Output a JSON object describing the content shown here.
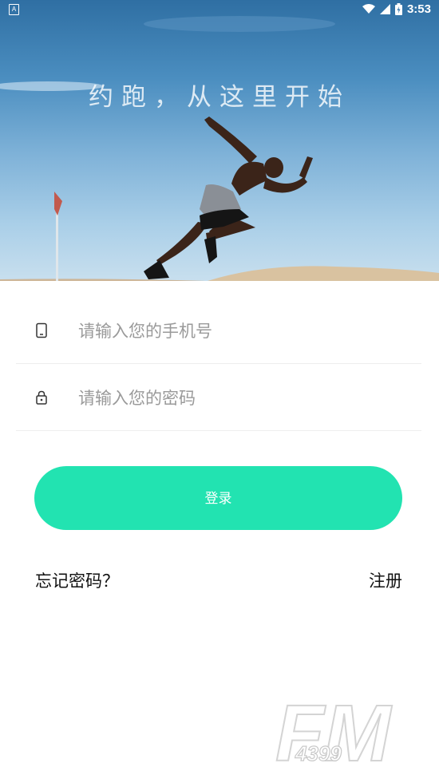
{
  "status_bar": {
    "time": "3:53",
    "left_badge": "A"
  },
  "hero": {
    "title": "约跑，从这里开始"
  },
  "form": {
    "phone_placeholder": "请输入您的手机号",
    "password_placeholder": "请输入您的密码"
  },
  "actions": {
    "login_label": "登录",
    "forgot_label": "忘记密码？",
    "register_label": "注册"
  },
  "watermark": {
    "brand_big": "FM",
    "brand_small": "4399"
  },
  "colors": {
    "accent": "#22e3b1",
    "divider": "#eeeeee",
    "placeholder": "#9a9a9a"
  },
  "icons": [
    "wifi-icon",
    "signal-icon",
    "battery-icon",
    "phone-icon",
    "lock-icon"
  ]
}
